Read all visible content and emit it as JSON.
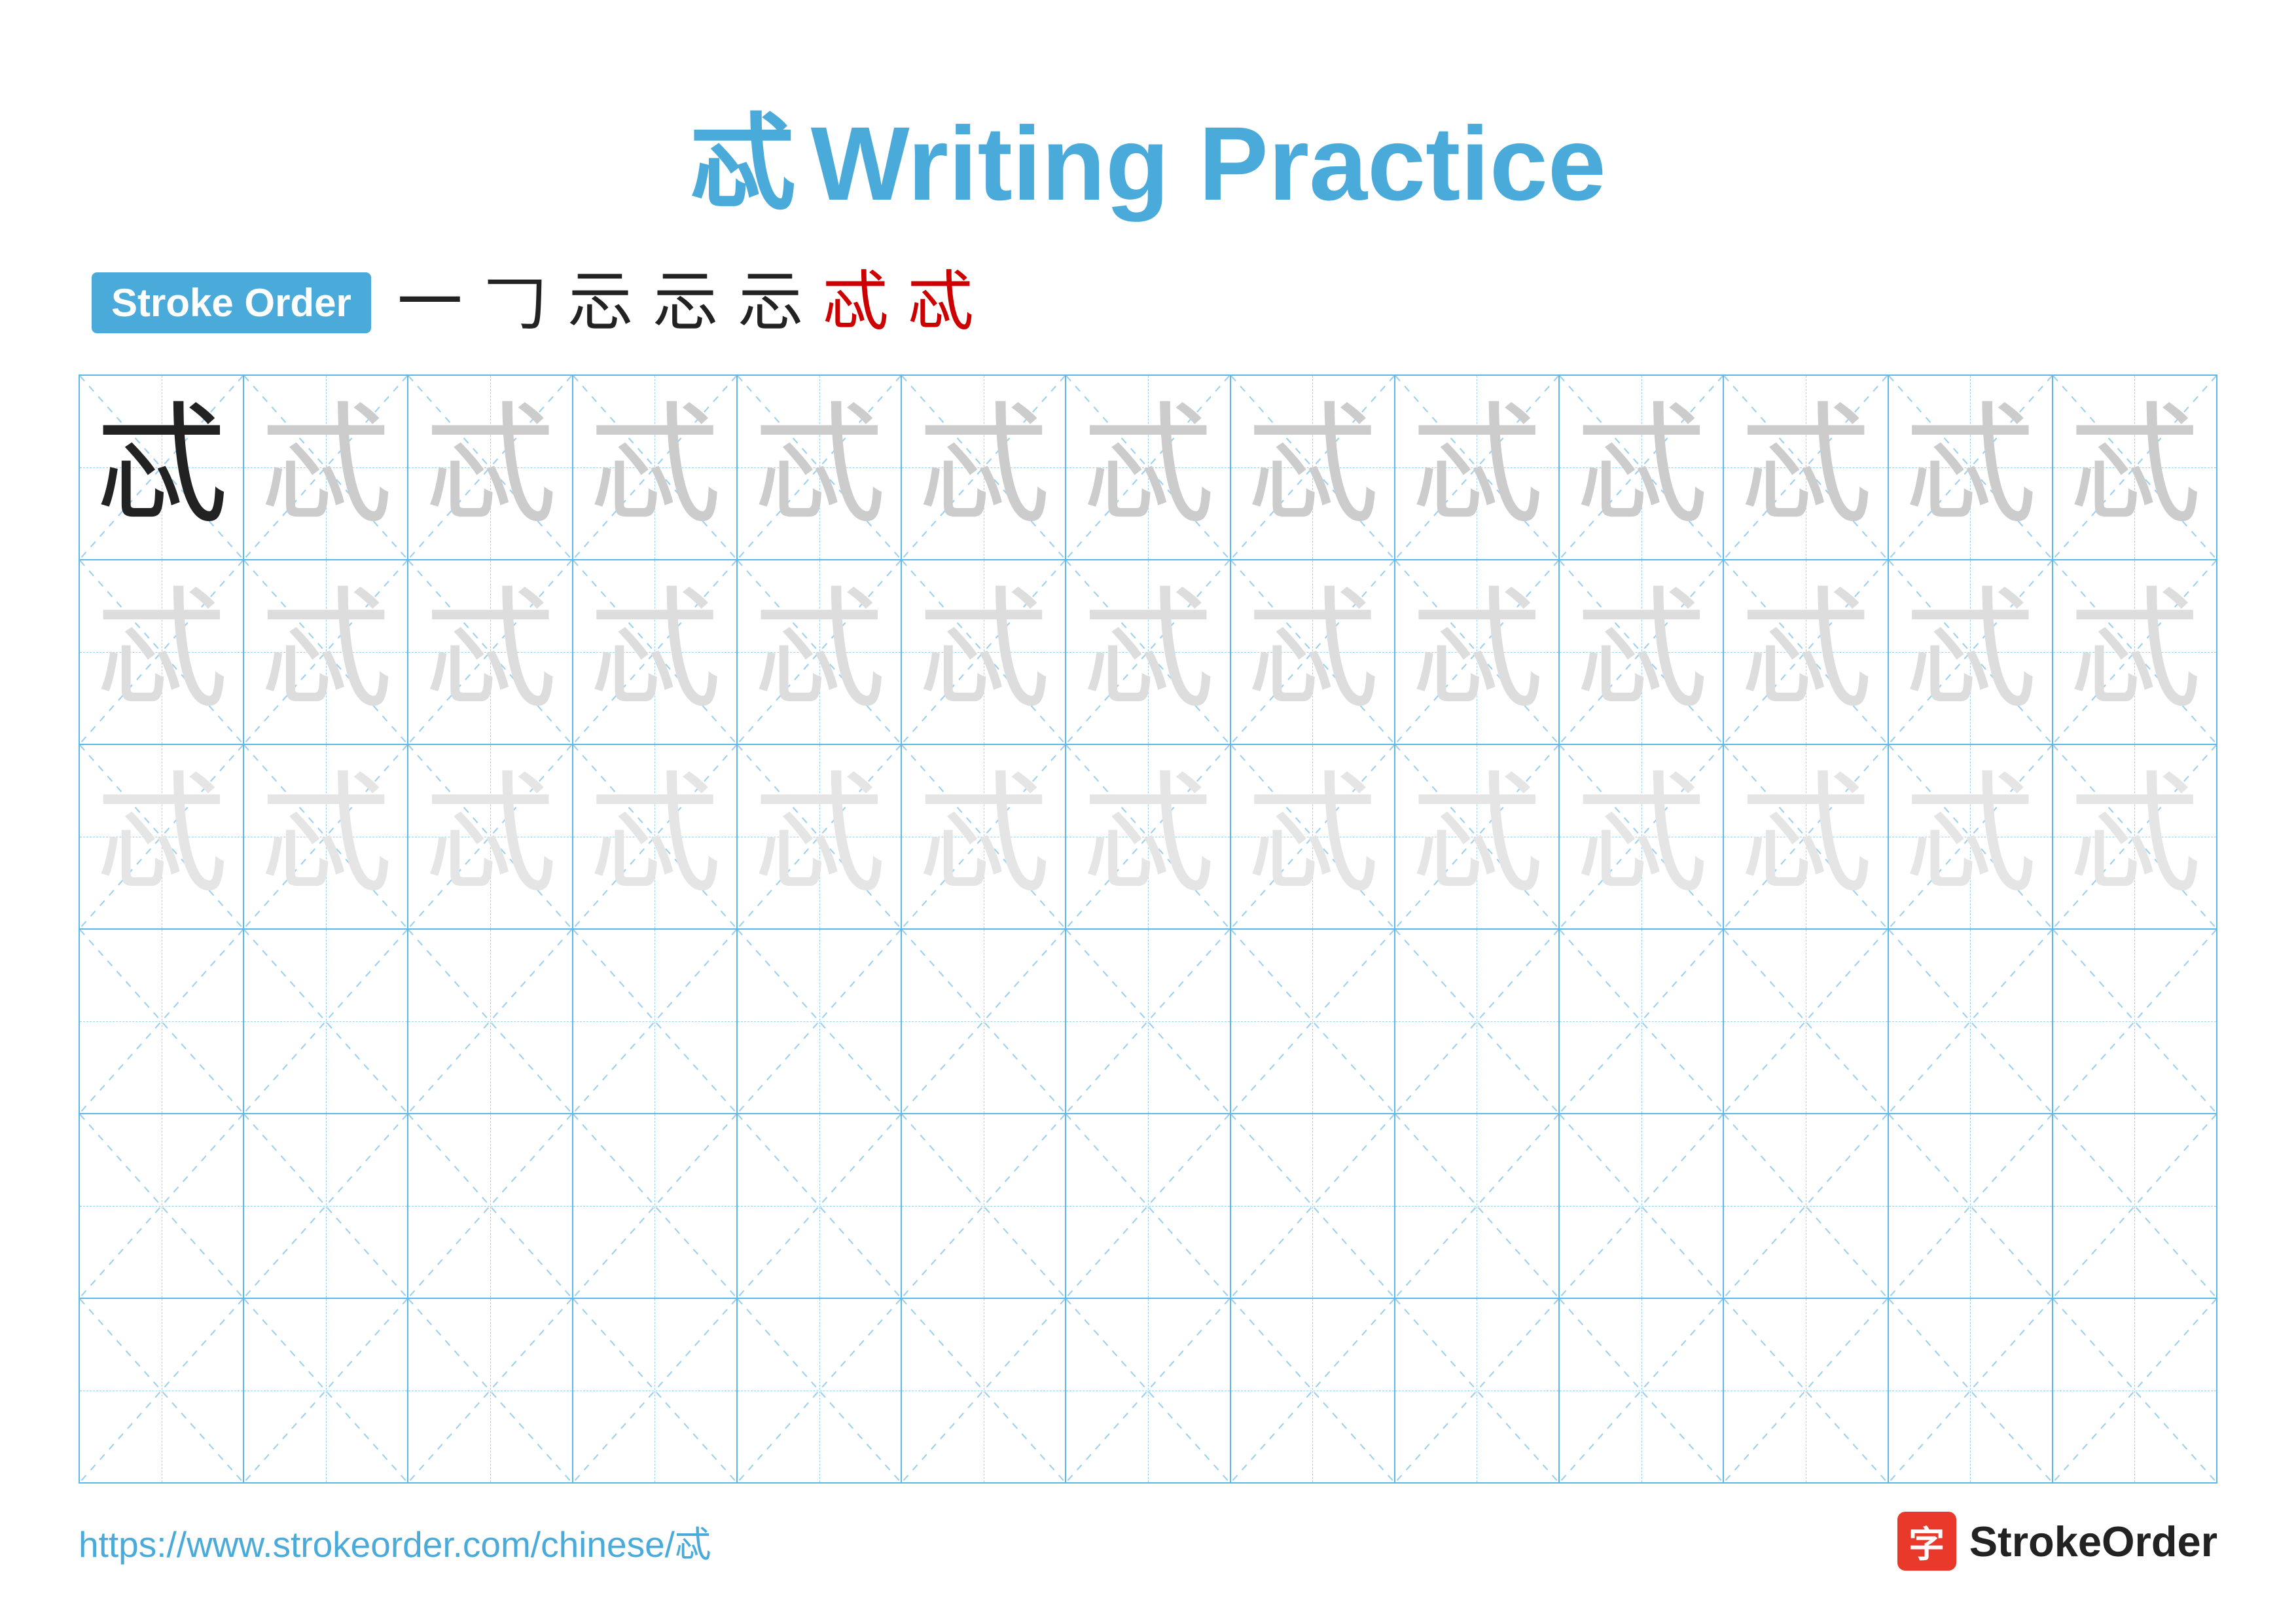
{
  "title": {
    "char": "忒",
    "text": "Writing Practice"
  },
  "stroke_order": {
    "badge_label": "Stroke Order",
    "strokes": [
      {
        "char": "一",
        "style": "black"
      },
      {
        "char": "𠃌",
        "style": "black"
      },
      {
        "char": "忈",
        "style": "black"
      },
      {
        "char": "忈",
        "style": "black"
      },
      {
        "char": "忈",
        "style": "black"
      },
      {
        "char": "忒",
        "style": "red"
      },
      {
        "char": "忒",
        "style": "red"
      }
    ]
  },
  "grid": {
    "rows": 6,
    "cols": 13,
    "practice_char": "忒",
    "filled_rows": [
      {
        "opacity": "dark",
        "first_dark": true
      },
      {
        "opacity": "light"
      },
      {
        "opacity": "lighter"
      },
      {
        "opacity": "empty"
      },
      {
        "opacity": "empty"
      },
      {
        "opacity": "empty"
      }
    ]
  },
  "footer": {
    "url": "https://www.strokeorder.com/chinese/忒",
    "logo_icon": "字",
    "logo_text": "StrokeOrder"
  }
}
